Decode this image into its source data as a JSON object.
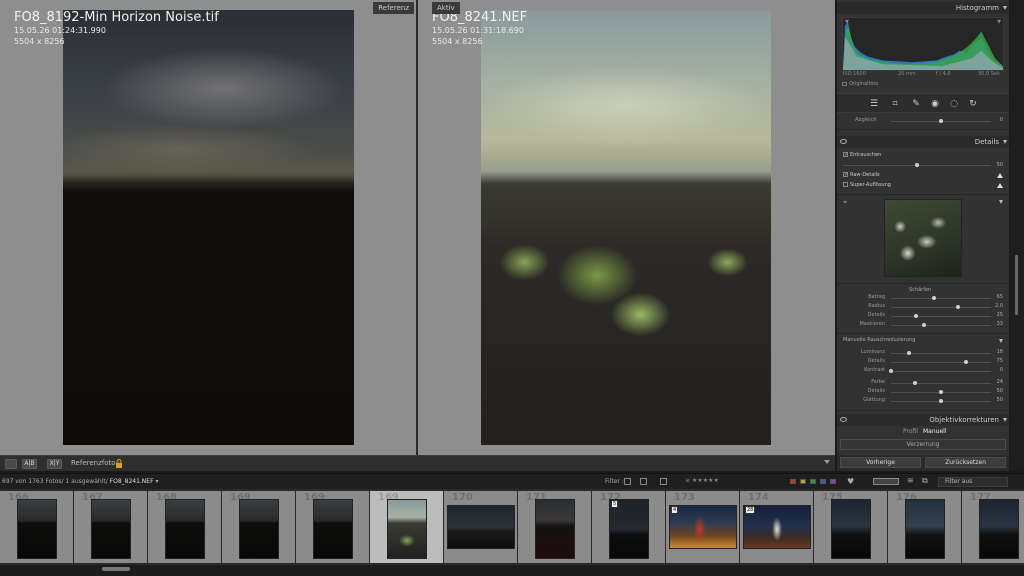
{
  "compare": {
    "reference": {
      "tag": "Referenz",
      "filename": "FO8_8192-Min Horizon Noise.tif",
      "datetime": "15.05.26 01:24:31.990",
      "dimensions": "5504 x 8256"
    },
    "active": {
      "tag": "Aktiv",
      "filename": "FO8_8241.NEF",
      "datetime": "15.05.26 01:31:18.690",
      "dimensions": "5504 x 8256"
    }
  },
  "compare_toolbar": {
    "ab_label": "A|B",
    "xy_label": "X|Y",
    "reference_label": "Referenzfoto :"
  },
  "right_panel": {
    "histogram": {
      "title": "Histogramm",
      "iso": "ISO 1600",
      "focal": "20 mm",
      "aperture": "f / 4,0",
      "shutter": "30,0 Sek",
      "original_photo": "Originalfoto"
    },
    "tools": [
      "settings-icon",
      "crop-icon",
      "healing-icon",
      "redeye-icon",
      "mask-icon",
      "reset-icon"
    ],
    "align_label": "Abgleich",
    "align_value": "0",
    "align_level": 0.5,
    "details": {
      "title": "Details",
      "denoise_label": "Entrauschen",
      "denoise_value": "50",
      "denoise_level": 0.5,
      "raw_details": "Raw-Details",
      "super_resolution": "Super-Auflösung",
      "sharpening_title": "Schärfen",
      "sharpening": [
        {
          "label": "Betrag",
          "value": "65",
          "level": 0.43
        },
        {
          "label": "Radius",
          "value": "2,0",
          "level": 0.67
        },
        {
          "label": "Details",
          "value": "25",
          "level": 0.25
        },
        {
          "label": "Maskieren",
          "value": "33",
          "level": 0.33
        }
      ],
      "manual_noise_title": "Manuelle Rauschreduzierung",
      "noise": [
        {
          "label": "Luminanz",
          "value": "18",
          "level": 0.18
        },
        {
          "label": "Details",
          "value": "75",
          "level": 0.75
        },
        {
          "label": "Kontrast",
          "value": "0",
          "level": 0.0
        }
      ],
      "color_noise": [
        {
          "label": "Farbe",
          "value": "24",
          "level": 0.24
        },
        {
          "label": "Details",
          "value": "50",
          "level": 0.5
        },
        {
          "label": "Glättung",
          "value": "50",
          "level": 0.5
        }
      ]
    },
    "lens": {
      "title": "Objektivkorrekturen",
      "tab_profile": "Profil",
      "tab_manual": "Manuell",
      "distortion": "Verzerrung"
    },
    "buttons": {
      "previous": "Vorherige",
      "reset": "Zurücksetzen"
    }
  },
  "filmstrip_header": {
    "count_text": "697 von 1763 Fotos/ 1 ausgewählt/",
    "filename": "FO8_8241.NEF",
    "filter_label": "Filter :",
    "filter_select": "Filter aus",
    "label_colors": [
      "#b33b3b",
      "#b7a83a",
      "#3f8f3f",
      "#3e5fa8",
      "#7d4b9a"
    ]
  },
  "filmstrip": [
    {
      "num": "166",
      "selected": false,
      "badge": ""
    },
    {
      "num": "167",
      "selected": false,
      "badge": ""
    },
    {
      "num": "168",
      "selected": false,
      "badge": ""
    },
    {
      "num": "169",
      "selected": false,
      "badge": ""
    },
    {
      "num": "169",
      "selected": false,
      "badge": ""
    },
    {
      "num": "169",
      "selected": true,
      "badge": ""
    },
    {
      "num": "170",
      "selected": false,
      "badge": ""
    },
    {
      "num": "171",
      "selected": false,
      "badge": ""
    },
    {
      "num": "172",
      "selected": false,
      "badge": "5"
    },
    {
      "num": "173",
      "selected": false,
      "badge": "4"
    },
    {
      "num": "174",
      "selected": false,
      "badge": "28"
    },
    {
      "num": "175",
      "selected": false,
      "badge": ""
    },
    {
      "num": "176",
      "selected": false,
      "badge": ""
    },
    {
      "num": "177",
      "selected": false,
      "badge": ""
    }
  ]
}
